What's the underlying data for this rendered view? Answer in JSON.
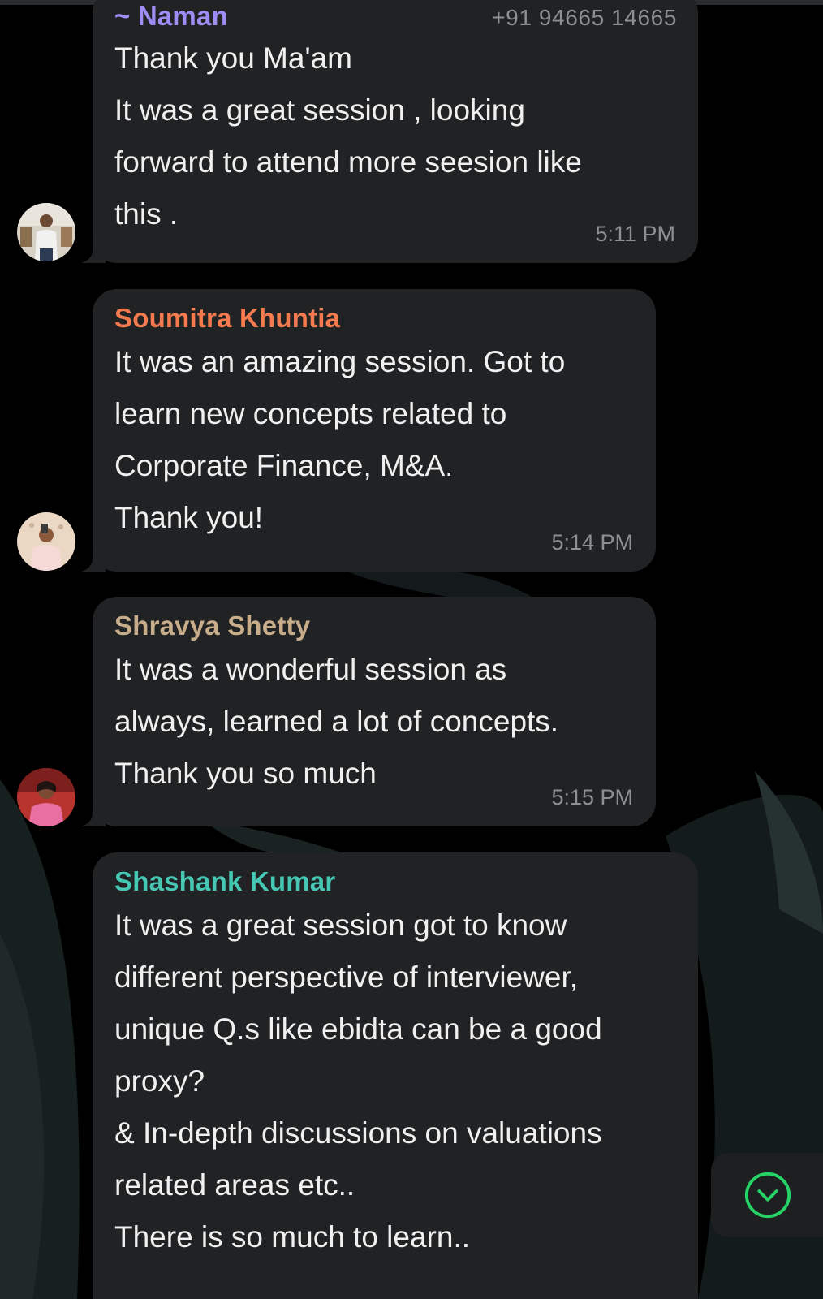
{
  "theme": {
    "bubble_bg": "#202224",
    "accent_green": "#25d366",
    "timestamp_color": "#8d8f92"
  },
  "messages": [
    {
      "sender": "~ Naman",
      "sender_color": "#a08cf5",
      "phone": "+91 94665 14665",
      "lines": [
        "Thank you Ma'am",
        "It was a great session , looking",
        "forward to attend more seesion like",
        "this ."
      ],
      "time": "5:11 PM",
      "avatar_icon": "avatar-photo-man-standing"
    },
    {
      "sender": "Soumitra Khuntia",
      "sender_color": "#f47a4f",
      "lines": [
        "It was an amazing session. Got to",
        "learn new concepts related to",
        "Corporate Finance, M&A.",
        "Thank you!"
      ],
      "time": "5:14 PM",
      "avatar_icon": "avatar-photo-man-selfie"
    },
    {
      "sender": "Shravya Shetty",
      "sender_color": "#c7ad8a",
      "lines": [
        "It was a wonderful session as",
        "always, learned a lot of concepts.",
        "Thank you so much"
      ],
      "time": "5:15 PM",
      "avatar_icon": "avatar-photo-woman"
    },
    {
      "sender": "Shashank Kumar",
      "sender_color": "#45c7b4",
      "lines": [
        "It was a great session got to know",
        "different perspective of interviewer,",
        "unique Q.s like ebidta can be a good",
        "proxy?",
        "& In-depth discussions on valuations",
        "related areas etc..",
        "There is so much to learn.."
      ],
      "time": "",
      "avatar_icon": ""
    }
  ],
  "scroll_button": {
    "icon": "chevron-down-circle-icon"
  }
}
